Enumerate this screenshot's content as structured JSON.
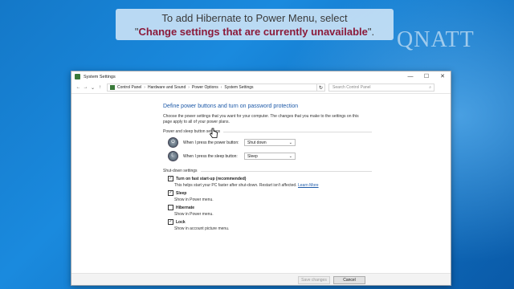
{
  "banner": {
    "line1": "To add Hibernate to Power Menu, select",
    "quote_open": "\"",
    "highlight": "Change settings that are currently unavailable",
    "quote_close": "\"."
  },
  "watermark": "QNATT",
  "window": {
    "title": "System Settings",
    "controls": {
      "minimize": "—",
      "maximize": "☐",
      "close": "✕"
    },
    "nav": {
      "back": "←",
      "forward": "→",
      "dropdown": "⌄",
      "up": "↑",
      "refresh": "↻"
    },
    "breadcrumbs": [
      "Control Panel",
      "Hardware and Sound",
      "Power Options",
      "System Settings"
    ],
    "search_placeholder": "Search Control Panel"
  },
  "content": {
    "heading": "Define power buttons and turn on password protection",
    "description": "Choose the power settings that you want for your computer. The changes that you make to the settings on this page apply to all of your power plans.",
    "power_section": "Power and sleep button settings",
    "rows": [
      {
        "label": "When I press the power button:",
        "value": "Shut down"
      },
      {
        "label": "When I press the sleep button:",
        "value": "Sleep"
      }
    ],
    "shutdown_section": "Shut-down settings",
    "options": [
      {
        "label": "Turn on fast start-up (recommended)",
        "checked": "✓",
        "desc": "This helps start your PC faster after shut-down. Restart isn't affected.",
        "link": "Learn More"
      },
      {
        "label": "Sleep",
        "checked": "✓",
        "desc": "Show in Power menu."
      },
      {
        "label": "Hibernate",
        "checked": "",
        "desc": "Show in Power menu."
      },
      {
        "label": "Lock",
        "checked": "✓",
        "desc": "Show in account picture menu."
      }
    ]
  },
  "footer": {
    "save": "Save changes",
    "cancel": "Cancel"
  },
  "colors": {
    "accent": "#1e5aa8",
    "banner_highlight": "#8b1a3a",
    "desktop": "#1478c8"
  }
}
